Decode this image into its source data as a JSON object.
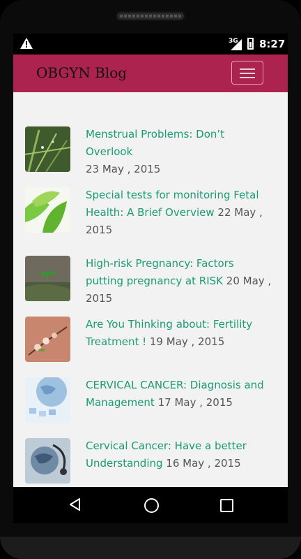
{
  "statusbar": {
    "signal_label": "3G",
    "time": "8:27",
    "icons": [
      "warning-icon",
      "signal-icon",
      "battery-icon"
    ]
  },
  "navbar": {
    "brand": "OBGYN Blog",
    "menu_icon": "hamburger-menu-icon"
  },
  "posts": [
    {
      "title": "Menstrual Problems: Don’t Overlook",
      "date": "23 May , 2015",
      "thumb": "green-grass-drops"
    },
    {
      "title": "Special tests for monitoring Fetal Health: A Brief Overview",
      "date": "22 May , 2015",
      "thumb": "green-leaves"
    },
    {
      "title": "High-risk Pregnancy: Factors putting pregnancy at RISK",
      "date": "20 May , 2015",
      "thumb": "sprout-on-log"
    },
    {
      "title": "Are You Thinking about: Fertility Treatment !",
      "date": "19 May , 2015",
      "thumb": "blossom-branch"
    },
    {
      "title": "CERVICAL CANCER: Diagnosis and Management",
      "date": "17 May , 2015",
      "thumb": "globe-puzzle"
    },
    {
      "title": "Cervical Cancer: Have a better Understanding",
      "date": "16 May , 2015",
      "thumb": "stethoscope-globe"
    }
  ],
  "system_nav": {
    "back": "back-icon",
    "home": "home-icon",
    "recents": "recents-icon"
  },
  "colors": {
    "navbar_bg": "#ad2350",
    "title_link": "#1a9b74",
    "date_text": "#555555",
    "page_bg": "#f2f2f2"
  }
}
